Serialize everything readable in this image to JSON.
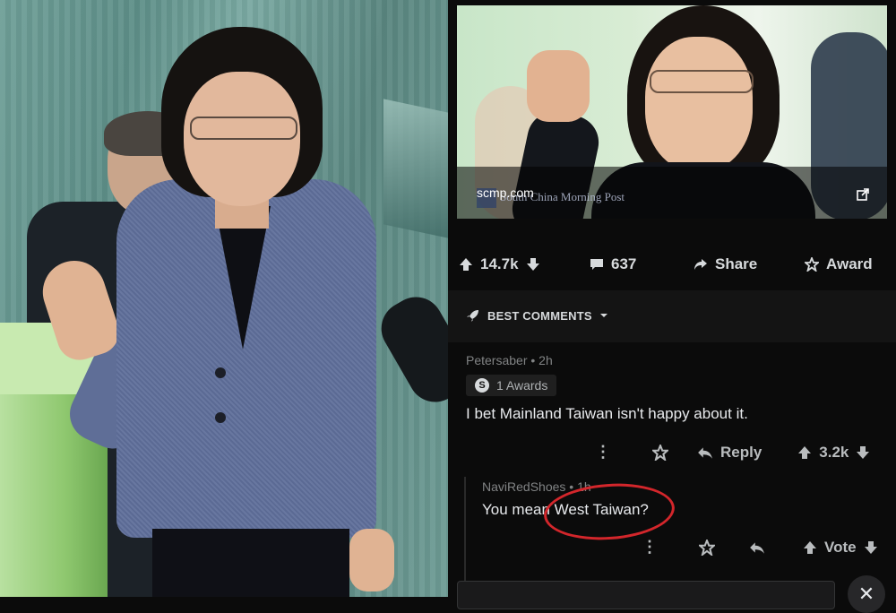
{
  "thumbnail": {
    "source_domain": "scmp.com",
    "source_name": "South China Morning Post"
  },
  "post_actions": {
    "score": "14.7k",
    "comments": "637",
    "share_label": "Share",
    "award_label": "Award"
  },
  "sort": {
    "label": "BEST COMMENTS"
  },
  "comments": [
    {
      "author": "Petersaber",
      "time": "2h",
      "awards": "1 Awards",
      "award_icon_letter": "S",
      "text": "I bet Mainland Taiwan isn't happy about it.",
      "reply_label": "Reply",
      "score": "3.2k"
    },
    {
      "author": "NaviRedShoes",
      "time": "1h",
      "text": "You mean West Taiwan?",
      "vote_label": "Vote"
    }
  ],
  "colors": {
    "reddit_dark_bg": "#0b0b0b",
    "text_primary": "#d7dadc",
    "text_meta": "#818384",
    "annotation_red": "#d3262b"
  }
}
